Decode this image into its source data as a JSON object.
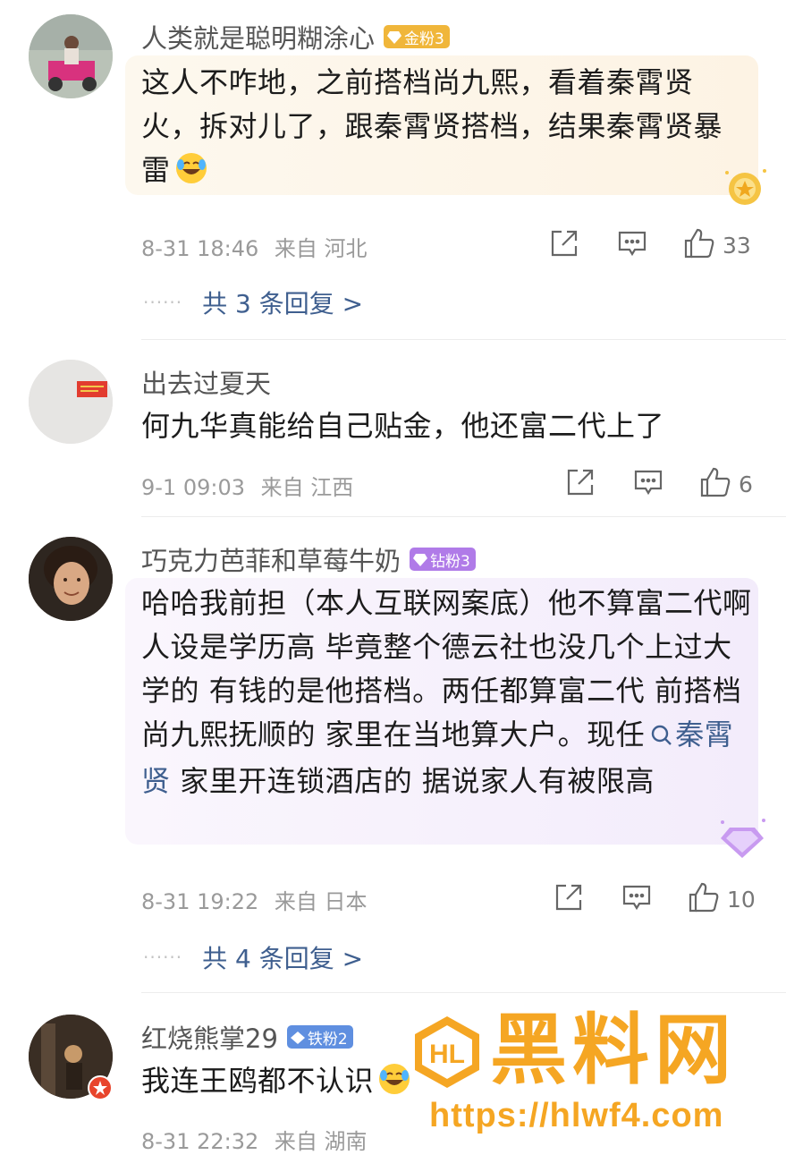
{
  "comments": [
    {
      "username": "人类就是聪明糊涂心",
      "badge": "金粉3",
      "badge_color": "#f0b63a",
      "text": "这人不咋地，之前搭档尚九熙，看着秦霄贤火，拆对儿了，跟秦霄贤搭档，结果秦霄贤暴雷",
      "emoji": "laugh-cry-emoji",
      "time": "8-31 18:46",
      "location": "来自 河北",
      "likes": "33",
      "replies": "共 3 条回复 >"
    },
    {
      "username": "出去过夏天",
      "text": "何九华真能给自己贴金，他还富二代上了",
      "time": "9-1 09:03",
      "location": "来自 江西",
      "likes": "6"
    },
    {
      "username": "巧克力芭菲和草莓牛奶",
      "badge": "钻粉3",
      "badge_color": "#b07be8",
      "text_before": "哈哈我前担（本人互联网案底）他不算富二代啊 人设是学历高 毕竟整个德云社也没几个上过大学的 有钱的是他搭档。两任都算富二代 前搭档尚九熙抚顺的 家里在当地算大户。现任",
      "topic": "秦霄贤",
      "text_after": " 家里开连锁酒店的 据说家人有被限高",
      "time": "8-31 19:22",
      "location": "来自 日本",
      "likes": "10",
      "replies": "共 4 条回复 >"
    },
    {
      "username": "红烧熊掌29",
      "badge": "铁粉2",
      "badge_color": "#5f8fe0",
      "text": "我连王鸥都不认识",
      "time": "8-31 22:32",
      "location": "来自 湖南"
    }
  ],
  "watermark": {
    "logo_text": "黑料网",
    "url": "https://hlwf4.com",
    "color": "#f5a623"
  },
  "icons": [
    "share-icon",
    "comment-icon",
    "like-icon"
  ]
}
